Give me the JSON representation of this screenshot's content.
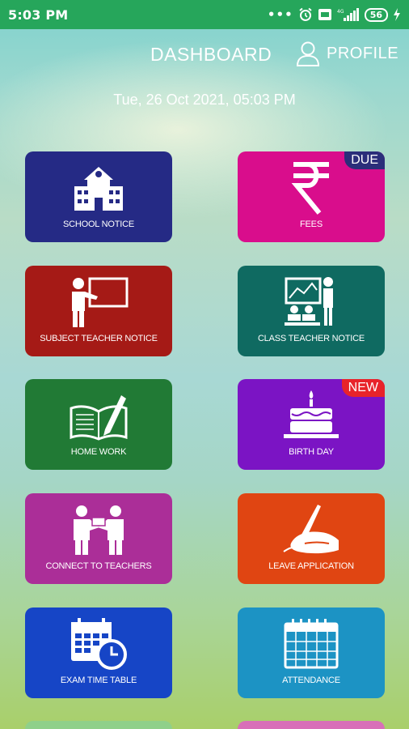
{
  "status_bar": {
    "time": "5:03 PM",
    "indicators": "•••",
    "battery": "56"
  },
  "header": {
    "title": "DASHBOARD",
    "profile_label": "PROFILE"
  },
  "datetime": "Tue, 26 Oct 2021, 05:03 PM",
  "tiles": [
    {
      "label": "SCHOOL NOTICE",
      "color": "#252a85",
      "icon": "school-building-icon"
    },
    {
      "label": "FEES",
      "color": "#d90d8c",
      "icon": "rupee-icon",
      "badge": "DUE"
    },
    {
      "label": "SUBJECT TEACHER NOTICE",
      "color": "#a51a16",
      "icon": "teacher-board-icon"
    },
    {
      "label": "CLASS TEACHER NOTICE",
      "color": "#0f6a61",
      "icon": "classroom-icon"
    },
    {
      "label": "HOME WORK",
      "color": "#217a35",
      "icon": "book-pen-icon"
    },
    {
      "label": "BIRTH DAY",
      "color": "#7b14c4",
      "icon": "birthday-cake-icon",
      "badge": "NEW"
    },
    {
      "label": "CONNECT TO TEACHERS",
      "color": "#ab2e98",
      "icon": "people-handshake-icon"
    },
    {
      "label": "LEAVE APPLICATION",
      "color": "#e04512",
      "icon": "hand-writing-icon"
    },
    {
      "label": "EXAM TIME TABLE",
      "color": "#1645c6",
      "icon": "calendar-clock-icon"
    },
    {
      "label": "ATTENDANCE",
      "color": "#1c93c4",
      "icon": "calendar-icon"
    }
  ],
  "peek_colors": [
    "#8fd08a",
    "#d86fb8"
  ]
}
